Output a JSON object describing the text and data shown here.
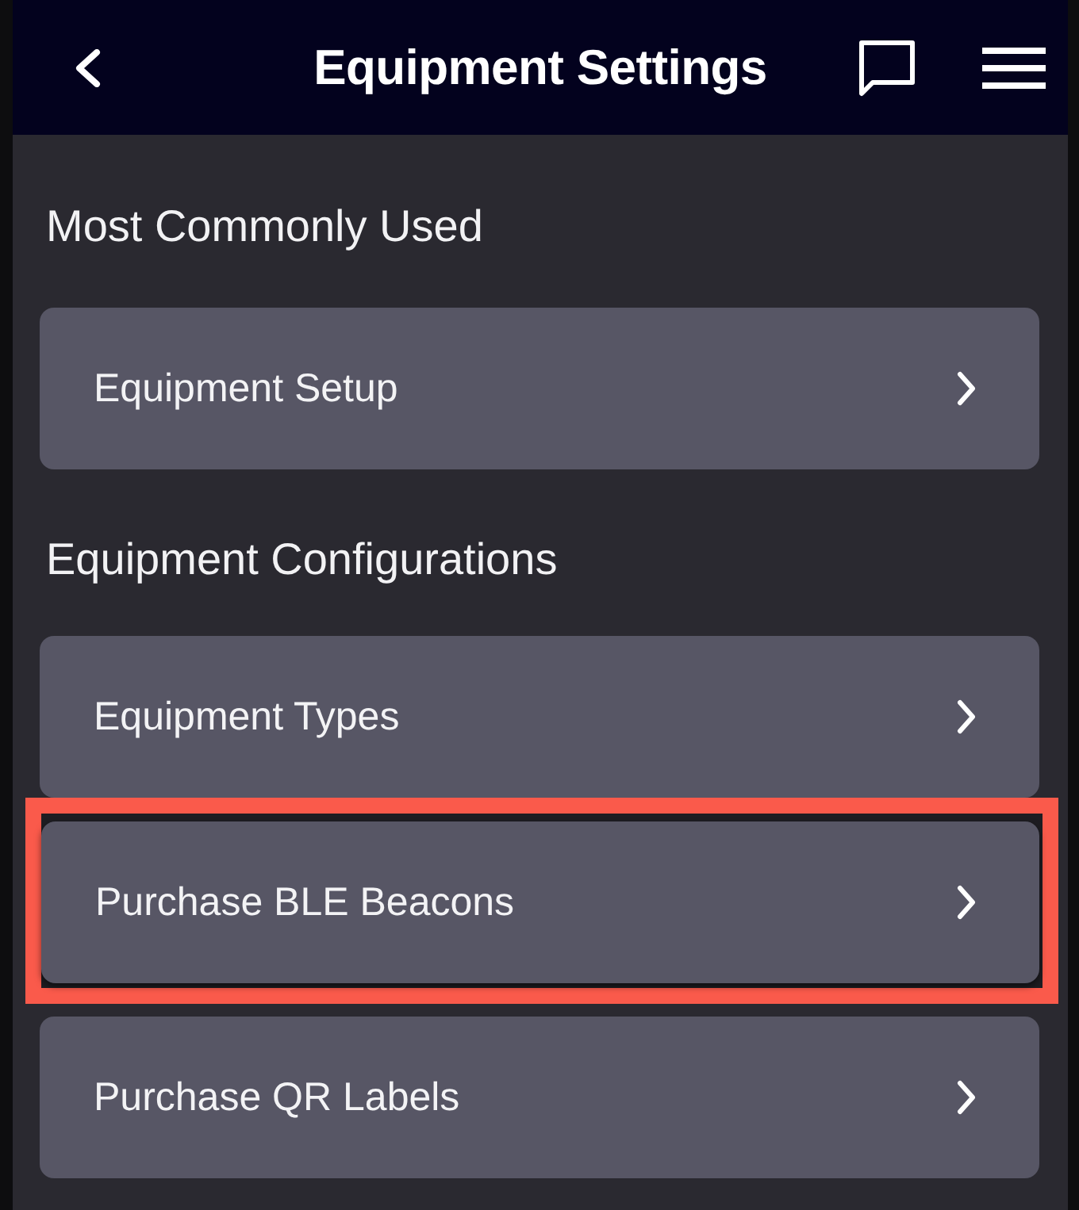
{
  "header": {
    "title": "Equipment Settings"
  },
  "sections": [
    {
      "heading": "Most Commonly Used",
      "items": [
        {
          "label": "Equipment Setup",
          "highlighted": false
        }
      ]
    },
    {
      "heading": "Equipment Configurations",
      "items": [
        {
          "label": "Equipment Types",
          "highlighted": false
        },
        {
          "label": "Purchase BLE Beacons",
          "highlighted": true
        },
        {
          "label": "Purchase QR Labels",
          "highlighted": false
        }
      ]
    }
  ]
}
